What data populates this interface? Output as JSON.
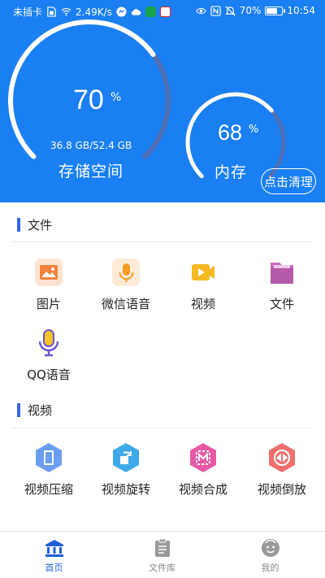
{
  "status_bar": {
    "carrier": "未插卡",
    "speed": "2.49K/s",
    "battery": "70%",
    "time": "10:54",
    "icons_left": [
      "sim-card-icon",
      "wifi-icon",
      "chat-app-icon",
      "cloud-icon",
      "app-icon",
      "edit-app-icon"
    ],
    "icons_right": [
      "eye-icon",
      "nfc-icon",
      "mute-bell-icon",
      "battery-icon"
    ]
  },
  "storage": {
    "percent": "70",
    "percent_value": 70,
    "percent_sign": "%",
    "size": "36.8 GB/52.4 GB",
    "label": "存储空间"
  },
  "memory": {
    "percent": "68",
    "percent_value": 68,
    "percent_sign": "%",
    "label": "内存"
  },
  "clean_button": "点击清理",
  "files_section": {
    "title": "文件",
    "items": [
      {
        "label": "图片",
        "icon": "image-icon"
      },
      {
        "label": "微信语音",
        "icon": "wechat-voice-icon"
      },
      {
        "label": "视频",
        "icon": "video-icon"
      },
      {
        "label": "文件",
        "icon": "folder-icon"
      },
      {
        "label": "QQ语音",
        "icon": "qq-voice-icon"
      }
    ]
  },
  "video_section": {
    "title": "视频",
    "items": [
      {
        "label": "视频压缩",
        "icon": "video-compress-icon"
      },
      {
        "label": "视频旋转",
        "icon": "video-rotate-icon"
      },
      {
        "label": "视频合成",
        "icon": "video-merge-icon"
      },
      {
        "label": "视频倒放",
        "icon": "video-reverse-icon"
      }
    ]
  },
  "bottom_nav": [
    {
      "label": "首页",
      "icon": "home-icon",
      "active": true
    },
    {
      "label": "文件库",
      "icon": "clipboard-icon",
      "active": false
    },
    {
      "label": "我的",
      "icon": "profile-icon",
      "active": false
    }
  ],
  "colors": {
    "header_bg": "#1a7ff2",
    "gauge_track": "#4f6fb4",
    "gauge_fill": "#ffffff",
    "accent": "#3566e8",
    "nav_active": "#1f5fd6"
  }
}
